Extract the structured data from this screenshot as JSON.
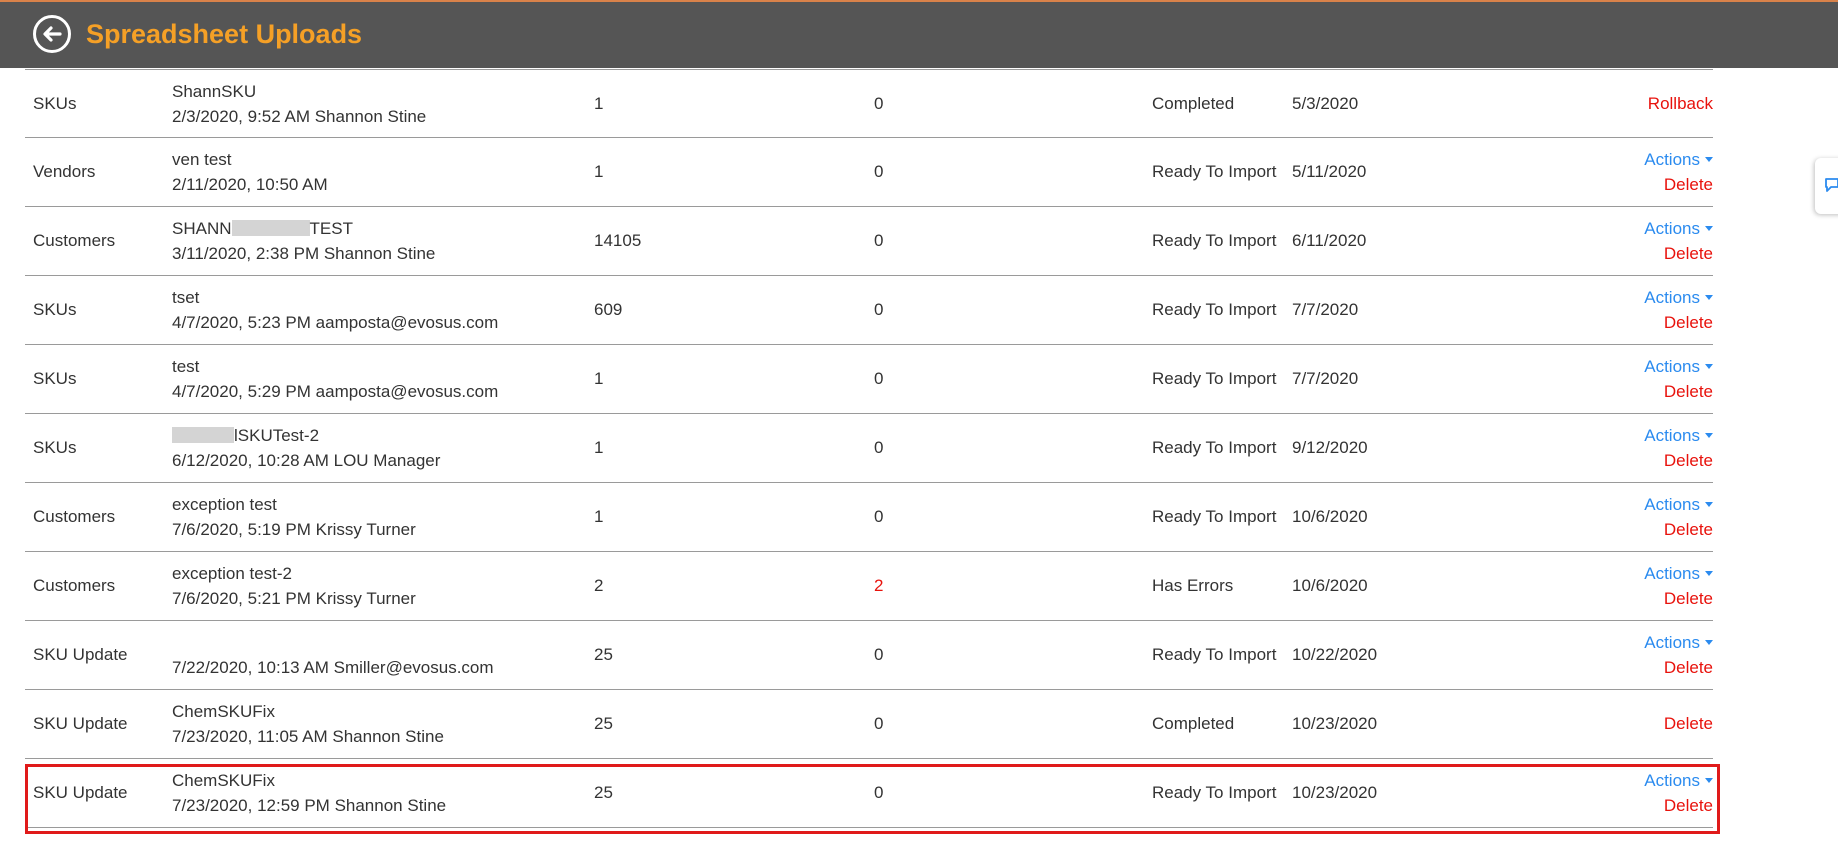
{
  "header": {
    "title": "Spreadsheet Uploads",
    "back_icon": "back-arrow-circle-icon",
    "background": "#555555",
    "title_color": "#f5a026"
  },
  "side_tab": {
    "icon": "chat-bubble-icon"
  },
  "colors": {
    "link": "#2b8bef",
    "danger": "#e8120c",
    "highlight": "#e01a1a"
  },
  "rows": [
    {
      "type": "SKUs",
      "name": "ShannSKU",
      "meta": "2/3/2020, 9:52 AM Shannon Stine",
      "count": "1",
      "errors": "0",
      "status": "Completed",
      "date": "5/3/2020",
      "link": "Rollback"
    },
    {
      "type": "Vendors",
      "name": "ven test",
      "meta": "2/11/2020, 10:50 AM",
      "count": "1",
      "errors": "0",
      "status": "Ready To Import",
      "date": "5/11/2020",
      "actions": "Actions",
      "delete": "Delete"
    },
    {
      "type": "Customers",
      "name_prefix": "SHANN",
      "name_suffix": "TEST",
      "meta": "3/11/2020, 2:38 PM Shannon Stine",
      "count": "14105",
      "errors": "0",
      "status": "Ready To Import",
      "date": "6/11/2020",
      "actions": "Actions",
      "delete": "Delete"
    },
    {
      "type": "SKUs",
      "name": "tset",
      "meta": "4/7/2020, 5:23 PM aamposta@evosus.com",
      "count": "609",
      "errors": "0",
      "status": "Ready To Import",
      "date": "7/7/2020",
      "actions": "Actions",
      "delete": "Delete"
    },
    {
      "type": "SKUs",
      "name": "test",
      "meta": "4/7/2020, 5:29 PM aamposta@evosus.com",
      "count": "1",
      "errors": "0",
      "status": "Ready To Import",
      "date": "7/7/2020",
      "actions": "Actions",
      "delete": "Delete"
    },
    {
      "type": "SKUs",
      "name_suffix": "lSKUTest-2",
      "meta": "6/12/2020, 10:28 AM LOU Manager",
      "count": "1",
      "errors": "0",
      "status": "Ready To Import",
      "date": "9/12/2020",
      "actions": "Actions",
      "delete": "Delete"
    },
    {
      "type": "Customers",
      "name": "exception test",
      "meta": "7/6/2020, 5:19 PM Krissy Turner",
      "count": "1",
      "errors": "0",
      "status": "Ready To Import",
      "date": "10/6/2020",
      "actions": "Actions",
      "delete": "Delete"
    },
    {
      "type": "Customers",
      "name": "exception test-2",
      "meta": "7/6/2020, 5:21 PM Krissy Turner",
      "count": "2",
      "errors": "2",
      "status": "Has Errors",
      "date": "10/6/2020",
      "actions": "Actions",
      "delete": "Delete"
    },
    {
      "type": "SKU Update",
      "name": "",
      "meta": "7/22/2020, 10:13 AM Smiller@evosus.com",
      "count": "25",
      "errors": "0",
      "status": "Ready To Import",
      "date": "10/22/2020",
      "actions": "Actions",
      "delete": "Delete"
    },
    {
      "type": "SKU Update",
      "name": "ChemSKUFix",
      "meta": "7/23/2020, 11:05 AM Shannon Stine",
      "count": "25",
      "errors": "0",
      "status": "Completed",
      "date": "10/23/2020",
      "link": "Delete"
    },
    {
      "type": "SKU Update",
      "name": "ChemSKUFix",
      "meta": "7/23/2020, 12:59 PM Shannon Stine",
      "count": "25",
      "errors": "0",
      "status": "Ready To Import",
      "date": "10/23/2020",
      "actions": "Actions",
      "delete": "Delete"
    }
  ]
}
